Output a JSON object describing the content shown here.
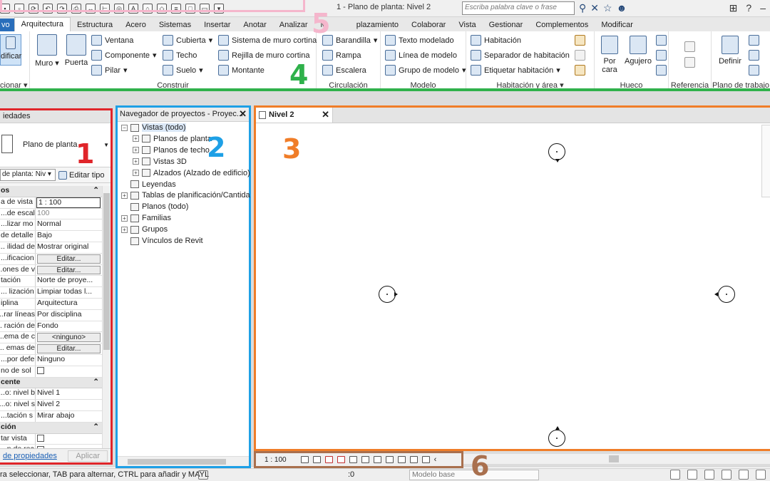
{
  "qat": {
    "title": "1 - Plano de planta: Nivel 2",
    "search_placeholder": "Escriba palabra clave o frase"
  },
  "tabs": [
    "vo",
    "Arquitectura",
    "Estructura",
    "Acero",
    "Sistemas",
    "Insertar",
    "Anotar",
    "Analizar",
    "M",
    "plazamiento",
    "Colaborar",
    "Vista",
    "Gestionar",
    "Complementos",
    "Modificar"
  ],
  "ribbon": {
    "select_label": "dificar",
    "select_group": "cionar",
    "build": {
      "muro": "Muro",
      "puerta": "Puerta",
      "ventana": "Ventana",
      "componente": "Componente",
      "pilar": "Pilar",
      "cubierta": "Cubierta",
      "techo": "Techo",
      "suelo": "Suelo",
      "sistema_muro": "Sistema de muro cortina",
      "rejilla_muro": "Rejilla de muro cortina",
      "montante": "Montante",
      "group": "Construir"
    },
    "circulation": {
      "barandilla": "Barandilla",
      "rampa": "Rampa",
      "escalera": "Escalera",
      "group": "Circulación"
    },
    "model": {
      "texto": "Texto modelado",
      "linea": "Línea de modelo",
      "grupo": "Grupo de modelo",
      "group": "Modelo"
    },
    "room": {
      "habitacion": "Habitación",
      "separador": "Separador de habitación",
      "etiquetar": "Etiquetar habitación",
      "group": "Habitación y área"
    },
    "opening": {
      "porcara": "Por cara",
      "agujero": "Agujero",
      "group": "Hueco"
    },
    "reference": {
      "group": "Referencia"
    },
    "workplane": {
      "definir": "Definir",
      "group": "Plano de trabajo"
    }
  },
  "properties": {
    "header": "iedades",
    "type_name": "Plano de planta",
    "filter": "de planta: Niv",
    "edit_type": "Editar tipo",
    "sections": [
      {
        "category": "os",
        "rows": [
          {
            "k": "a de vista",
            "v": "1 : 100",
            "style": "inp"
          },
          {
            "k": "de escal...",
            "v": "100",
            "style": "gray"
          },
          {
            "k": "lizar mo...",
            "v": "Normal"
          },
          {
            "k": "de detalle",
            "v": "Bajo"
          },
          {
            "k": "ilidad de ...",
            "v": "Mostrar original"
          },
          {
            "k": "ificacion...",
            "v": "Editar...",
            "style": "btn"
          },
          {
            "k": "ones de v...",
            "v": "Editar...",
            "style": "btn"
          },
          {
            "k": "tación",
            "v": "Norte de proye..."
          },
          {
            "k": "lización ...",
            "v": "Limpiar todas l..."
          },
          {
            "k": "iplina",
            "v": "Arquitectura"
          },
          {
            "k": "rar líneas...",
            "v": "Por disciplina"
          },
          {
            "k": "ración de ...",
            "v": "Fondo"
          },
          {
            "k": "ema de c...",
            "v": "<ninguno>",
            "style": "btn"
          },
          {
            "k": "emas de ...",
            "v": "Editar...",
            "style": "btn"
          },
          {
            "k": "por defe...",
            "v": "Ninguno"
          },
          {
            "k": "no de sol",
            "v": "",
            "style": "cb"
          }
        ]
      },
      {
        "category": "cente",
        "rows": [
          {
            "k": "o: nivel b...",
            "v": "Nivel 1"
          },
          {
            "k": "o: nivel s...",
            "v": "Nivel 2"
          },
          {
            "k": "tación s...",
            "v": "Mirar abajo"
          }
        ]
      },
      {
        "category": "ción",
        "rows": [
          {
            "k": "tar vista",
            "v": "",
            "style": "cb"
          },
          {
            "k": "n de rec...",
            "v": "",
            "style": "cb"
          }
        ]
      }
    ],
    "help_link": "de propiedades",
    "apply": "Aplicar"
  },
  "browser": {
    "title": "Navegador de proyectos - Proyec...",
    "nodes": [
      {
        "label": "Vistas (todo)",
        "level": 0,
        "pm": "−",
        "sel": true
      },
      {
        "label": "Planos de planta",
        "level": 1,
        "pm": "+"
      },
      {
        "label": "Planos de techo",
        "level": 1,
        "pm": "+"
      },
      {
        "label": "Vistas 3D",
        "level": 1,
        "pm": "+"
      },
      {
        "label": "Alzados (Alzado de edificio)",
        "level": 1,
        "pm": "+"
      },
      {
        "label": "Leyendas",
        "level": 0,
        "pm": ""
      },
      {
        "label": "Tablas de planificación/Cantida",
        "level": 0,
        "pm": "+"
      },
      {
        "label": "Planos (todo)",
        "level": 0,
        "pm": ""
      },
      {
        "label": "Familias",
        "level": 0,
        "pm": "+"
      },
      {
        "label": "Grupos",
        "level": 0,
        "pm": "+"
      },
      {
        "label": "Vínculos de Revit",
        "level": 0,
        "pm": ""
      }
    ]
  },
  "view": {
    "tab": "Nivel 2"
  },
  "vcb": {
    "scale": "1 : 100"
  },
  "status": {
    "text": "ra seleccionar, TAB para alternar, CTRL para añadir y MAYL",
    "zero": ":0",
    "model": "Modelo base"
  },
  "annotations": [
    {
      "n": "1",
      "color": "#e0252a"
    },
    {
      "n": "2",
      "color": "#1ea0e6"
    },
    {
      "n": "3",
      "color": "#f07d28"
    },
    {
      "n": "4",
      "color": "#2fb14b"
    },
    {
      "n": "5",
      "color": "#f5b6cc"
    },
    {
      "n": "6",
      "color": "#a9704e"
    }
  ]
}
